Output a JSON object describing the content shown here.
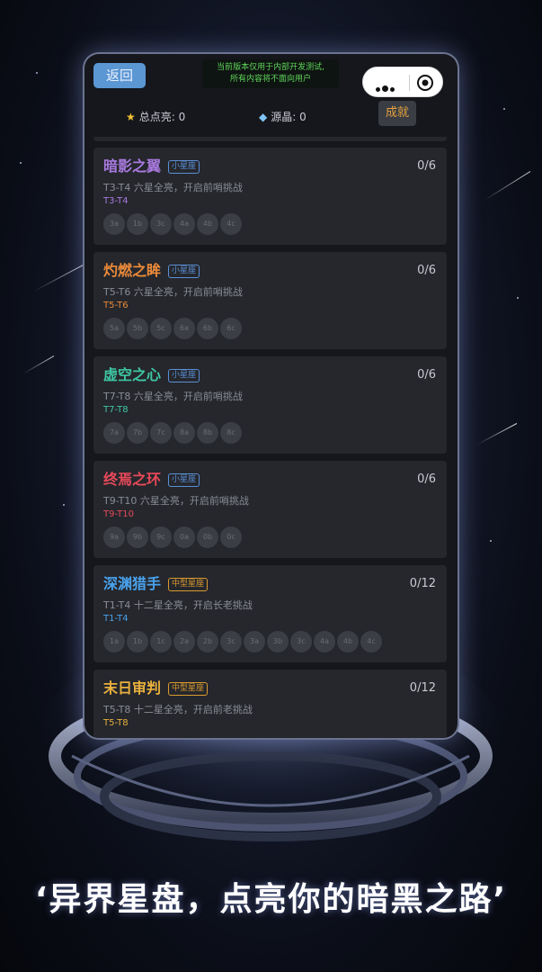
{
  "header": {
    "back_label": "返回",
    "notice_line1": "当前版本仅用于内部开发测试,",
    "notice_line2": "所有内容将不面向用户"
  },
  "capsule": {
    "more_icon": "more-dots-icon",
    "close_icon": "target-circle-icon"
  },
  "stats": {
    "total_label": "总点亮: 0",
    "total_icon": "star-icon",
    "crystal_label": "源晶: 0",
    "crystal_icon": "diamond-icon",
    "achievement_label": "成就"
  },
  "colors": {
    "purple": "#a97ae0",
    "orange": "#ea8a3a",
    "teal": "#3fc7a5",
    "red": "#e8495a",
    "blue": "#4aa3ee",
    "gold": "#e9b03d",
    "badge_small": "#5b8fd6",
    "badge_medium": "#d99a30"
  },
  "cards": [
    {
      "title": "暗影之翼",
      "badge": "小星座",
      "badge_type": "small",
      "count": "0/6",
      "desc": "T3-T4 六星全亮，开启前哨挑战",
      "tier": "T3-T4",
      "color": "#a97ae0",
      "nodes": [
        "3a",
        "1b",
        "3c",
        "4a",
        "4b",
        "4c"
      ]
    },
    {
      "title": "灼燃之眸",
      "badge": "小星座",
      "badge_type": "small",
      "count": "0/6",
      "desc": "T5-T6 六星全亮，开启前哨挑战",
      "tier": "T5-T6",
      "color": "#ea8a3a",
      "nodes": [
        "5a",
        "5b",
        "5c",
        "6a",
        "6b",
        "6c"
      ]
    },
    {
      "title": "虚空之心",
      "badge": "小星座",
      "badge_type": "small",
      "count": "0/6",
      "desc": "T7-T8 六星全亮，开启前哨挑战",
      "tier": "T7-T8",
      "color": "#3fc7a5",
      "nodes": [
        "7a",
        "7b",
        "7c",
        "8a",
        "8b",
        "8c"
      ]
    },
    {
      "title": "终焉之环",
      "badge": "小星座",
      "badge_type": "small",
      "count": "0/6",
      "desc": "T9-T10 六星全亮，开启前哨挑战",
      "tier": "T9-T10",
      "color": "#e8495a",
      "nodes": [
        "9a",
        "9b",
        "9c",
        "0a",
        "0b",
        "0c"
      ]
    },
    {
      "title": "深渊猎手",
      "badge": "中型星座",
      "badge_type": "medium",
      "count": "0/12",
      "desc": "T1-T4 十二星全亮，开启长老挑战",
      "tier": "T1-T4",
      "color": "#4aa3ee",
      "nodes": [
        "1a",
        "1b",
        "1c",
        "2a",
        "2b",
        "3c",
        "3a",
        "3b",
        "3c",
        "4a",
        "4b",
        "4c"
      ]
    },
    {
      "title": "末日审判",
      "badge": "中型星座",
      "badge_type": "medium",
      "count": "0/12",
      "desc": "T5-T8 十二星全亮，开启前老挑战",
      "tier": "T5-T8",
      "color": "#e9b03d",
      "nodes": []
    }
  ],
  "slogan": "‘异界星盘，点亮你的暗黑之路’"
}
